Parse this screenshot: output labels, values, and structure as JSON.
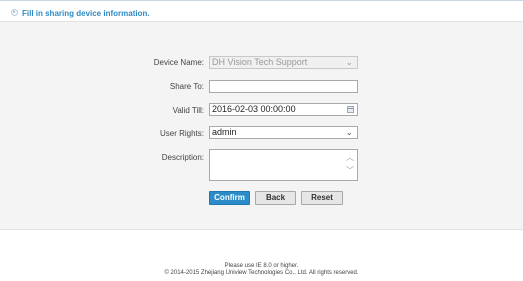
{
  "header": {
    "title": "Fill in sharing device information."
  },
  "form": {
    "device_name": {
      "label": "Device Name:",
      "value": "DH Vision Tech Support",
      "disabled": true
    },
    "share_to": {
      "label": "Share To:",
      "value": ""
    },
    "valid_till": {
      "label": "Valid Till:",
      "value": "2016-02-03 00:00:00"
    },
    "user_rights": {
      "label": "User Rights:",
      "value": "admin"
    },
    "description": {
      "label": "Description:",
      "value": ""
    }
  },
  "buttons": {
    "confirm": "Confirm",
    "back": "Back",
    "reset": "Reset"
  },
  "footer": {
    "line1": "Please use IE 8.0 or higher.",
    "line2": "© 2014-2015 Zhejiang Uniview Technologies Co., Ltd. All rights reserved."
  },
  "icons": {
    "header": "arrow-right-icon",
    "select": "chevron-down-icon",
    "date": "calendar-icon",
    "scroll": "scroll-arrows-icon"
  },
  "colors": {
    "accent": "#2f8ac4",
    "confirm_button": "#2d8cc7",
    "panel_background": "#f4f4f4"
  }
}
